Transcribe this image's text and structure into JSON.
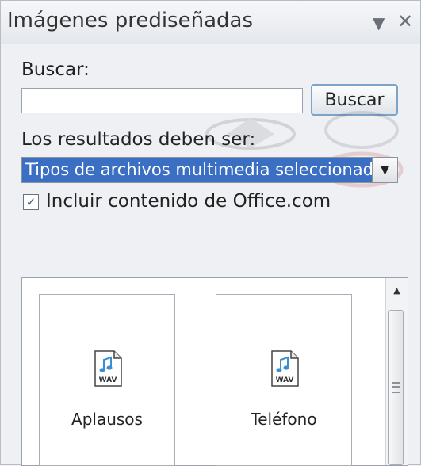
{
  "panel": {
    "title": "Imágenes prediseñadas",
    "dropdown_icon": "triangle-down-icon",
    "close_icon": "close-icon"
  },
  "search": {
    "label": "Buscar:",
    "value": "",
    "button_label": "Buscar"
  },
  "results_filter": {
    "label": "Los resultados deben ser:",
    "selected_value": "Tipos de archivos multimedia seleccionados"
  },
  "office_option": {
    "checked": true,
    "label": "Incluir contenido de Office.com"
  },
  "results": {
    "items": [
      {
        "label": "Aplausos",
        "icon": "wav-file-icon",
        "badge": "WAV"
      },
      {
        "label": "Teléfono",
        "icon": "wav-file-icon",
        "badge": "WAV"
      }
    ]
  },
  "colors": {
    "selection": "#3a6fc4",
    "button_border": "#7da3c9",
    "audio_note": "#3a8fd0"
  }
}
